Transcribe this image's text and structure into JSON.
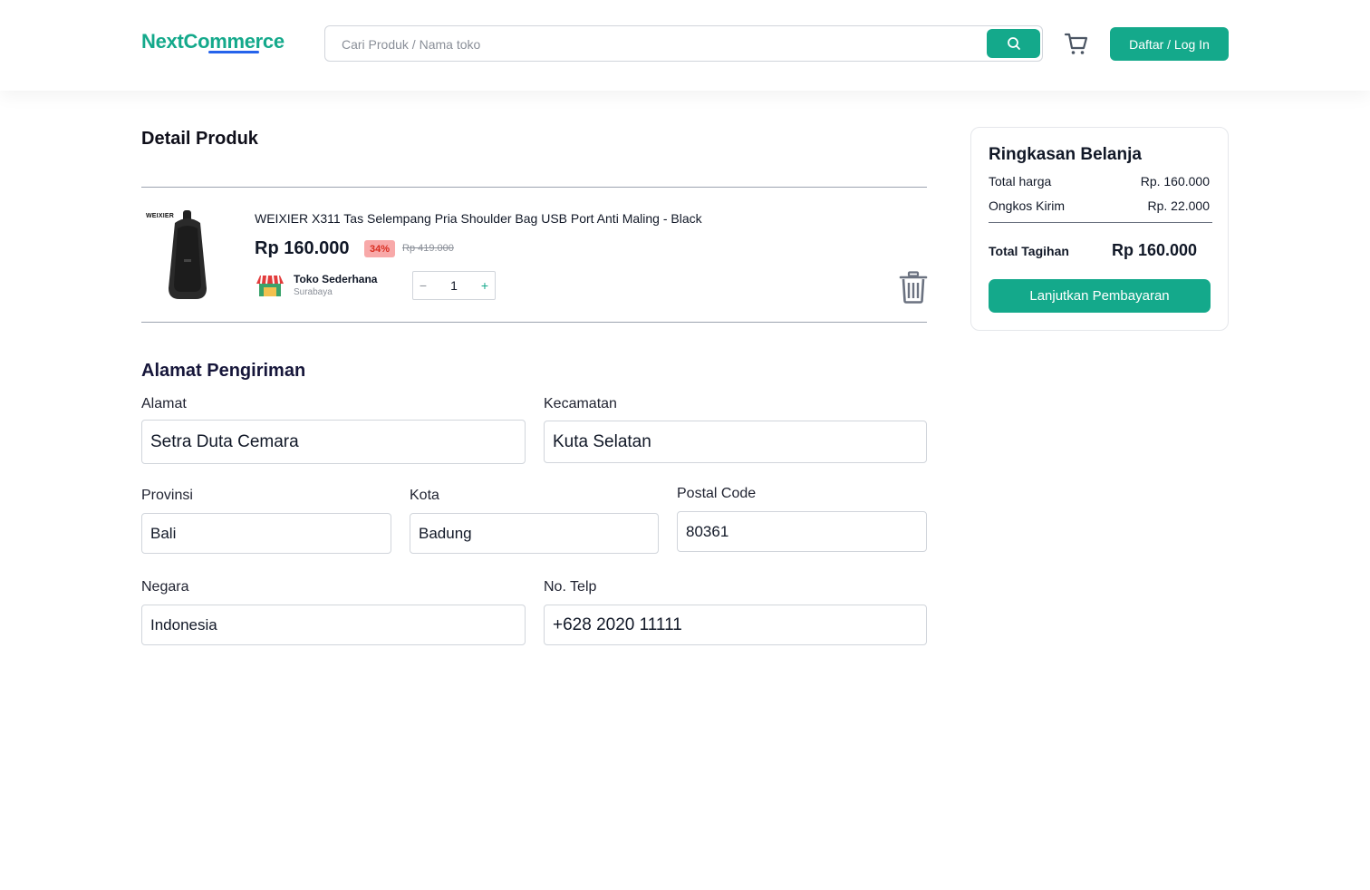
{
  "header": {
    "logo": "NextCommerce",
    "search_placeholder": "Cari Produk / Nama toko",
    "login_label": "Daftar / Log In"
  },
  "product_section": {
    "title": "Detail Produk",
    "item": {
      "brand": "WEIXIER",
      "name": "WEIXIER X311 Tas Selempang Pria Shoulder Bag USB Port Anti Maling - Black",
      "price": "Rp 160.000",
      "discount": "34%",
      "old_price": "Rp 419.000",
      "store_name": "Toko Sederhana",
      "store_city": "Surabaya",
      "quantity": "1",
      "qty_minus": "−",
      "qty_plus": "+"
    }
  },
  "address": {
    "title": "Alamat Pengiriman",
    "alamat": {
      "label": "Alamat",
      "value": "Setra Duta Cemara"
    },
    "kecamatan": {
      "label": "Kecamatan",
      "value": "Kuta Selatan"
    },
    "provinsi": {
      "label": "Provinsi",
      "value": "Bali"
    },
    "kota": {
      "label": "Kota",
      "value": "Badung"
    },
    "postal_code": {
      "label": "Postal Code",
      "value": "80361"
    },
    "negara": {
      "label": "Negara",
      "value": "Indonesia"
    },
    "telp": {
      "label": "No. Telp",
      "value": "+628 2020 11111"
    }
  },
  "summary": {
    "title": "Ringkasan Belanja",
    "total_harga_label": "Total harga",
    "total_harga_value": "Rp. 160.000",
    "ongkir_label": "Ongkos Kirim",
    "ongkir_value": "Rp. 22.000",
    "total_tagihan_label": "Total Tagihan",
    "total_tagihan_value": "Rp 160.000",
    "checkout_label": "Lanjutkan Pembayaran"
  },
  "colors": {
    "accent": "#14a98b",
    "discount_bg": "#f8a9a9",
    "discount_text": "#d92d20"
  }
}
